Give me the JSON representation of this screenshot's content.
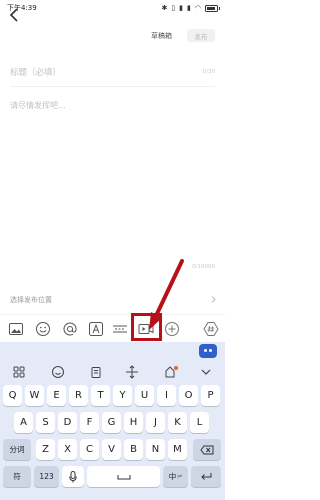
{
  "status_bar": {
    "time": "下午4:39",
    "icons": [
      "bluetooth-icon",
      "vibrate-icon",
      "signal-icon",
      "signal-icon",
      "wifi-icon",
      "battery-icon"
    ]
  },
  "header": {
    "back_icon": "chevron-left-icon",
    "drafts_label": "草稿箱",
    "publish_label": "发布"
  },
  "editor": {
    "title_placeholder": "标题（必填）",
    "title_counter": "0/30",
    "body_placeholder": "请尽情发挥吧...",
    "body_counter": "0/10000"
  },
  "location": {
    "label": "选择发布位置",
    "icon": "chevron-right-icon"
  },
  "toolbar": {
    "tools": [
      "image-icon",
      "emoji-icon",
      "at-icon",
      "text-format-icon",
      "divider-icon",
      "video-icon",
      "add-icon",
      "hashtag-icon"
    ],
    "highlighted": "video-icon"
  },
  "annotation": {
    "highlight_color": "#b80f1a",
    "arrow_color": "#b80f1a"
  },
  "keyboard": {
    "top_row_icons": [
      "grid-icon",
      "emoji-icon",
      "clipboard-icon",
      "cursor-move-icon",
      "keyboard-skin-icon",
      "collapse-icon"
    ],
    "row1": [
      "Q",
      "W",
      "E",
      "R",
      "T",
      "Y",
      "U",
      "I",
      "O",
      "P"
    ],
    "row2": [
      "A",
      "S",
      "D",
      "F",
      "G",
      "H",
      "J",
      "K",
      "L"
    ],
    "row3": [
      "分词",
      "Z",
      "X",
      "C",
      "V",
      "B",
      "N",
      "M"
    ],
    "row4": [
      "符",
      "123",
      "中",
      "⇌"
    ],
    "backspace_icon": "backspace-icon",
    "mic_icon": "microphone-icon",
    "enter_icon": "enter-icon",
    "space_icon": "space-icon"
  }
}
